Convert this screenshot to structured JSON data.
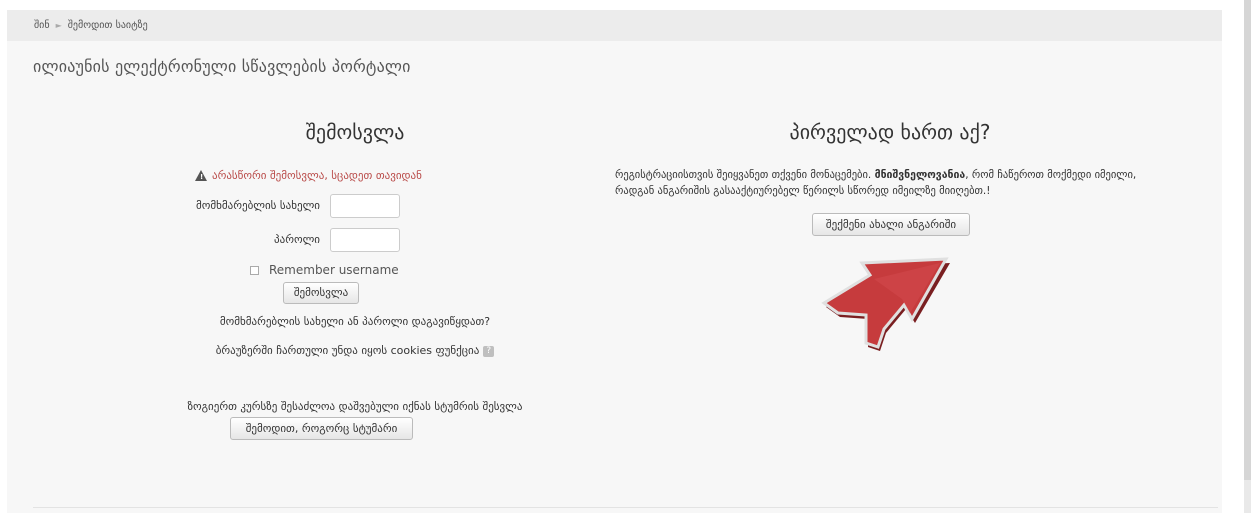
{
  "breadcrumb": {
    "home": "შინ",
    "separator": "►",
    "current": "შემოდით საიტზე"
  },
  "site_title": "ილიაუნის ელექტრონული სწავლების პორტალი",
  "login": {
    "heading": "შემოსვლა",
    "error": "არასწორი შემოსვლა, სცადეთ თავიდან",
    "username_label": "მომხმარებლის სახელი",
    "username_value": "",
    "password_label": "პაროლი",
    "password_value": "",
    "remember_label": "Remember username",
    "submit_label": "შემოსვლა",
    "forgot_text": "მომხმარებლის სახელი ან პაროლი დაგავიწყდათ?",
    "cookies_text": "ბრაუზერში ჩართული უნდა იყოს cookies ფუნქცია",
    "cookies_help_icon": "?",
    "guest_text": "ზოგიერთ კურსზე შესაძლოა დაშვებული იქნას სტუმრის შესვლა",
    "guest_button": "შემოდით, როგორც სტუმარი"
  },
  "signup": {
    "heading": "პირველად ხართ აქ?",
    "text_before": "რეგისტრაციისთვის შეიყვანეთ თქვენი მონაცემები. ",
    "text_bold": "მნიშვნელოვანია",
    "text_after": ", რომ ჩაწეროთ მოქმედი იმეილი, რადგან ანგარიშის გასააქტიურებელ წერილს სწორედ იმეილზე მიიღებთ.!",
    "button": "შექმენი ახალი ანგარიში"
  },
  "colors": {
    "error": "#b94a48",
    "arrow": "#c0393b",
    "background": "#f7f7f7"
  }
}
